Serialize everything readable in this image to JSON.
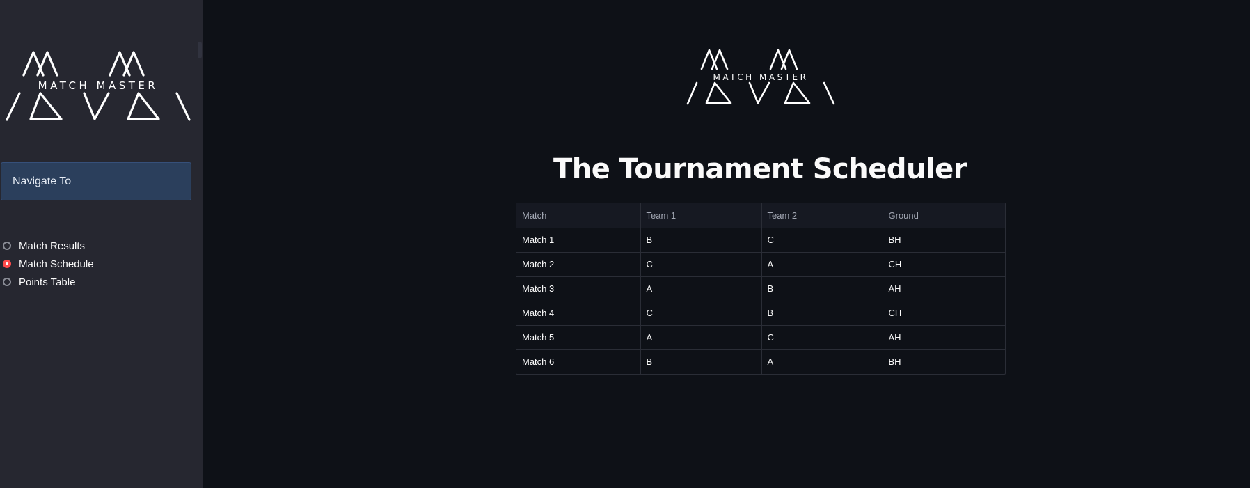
{
  "app": {
    "logo_text": "MATCH MASTER"
  },
  "sidebar": {
    "nav_label": "Navigate To",
    "radio_options": [
      {
        "label": "Match Results",
        "selected": false
      },
      {
        "label": "Match Schedule",
        "selected": true
      },
      {
        "label": "Points Table",
        "selected": false
      }
    ]
  },
  "main": {
    "title": "The Tournament Scheduler",
    "table": {
      "headers": [
        "Match",
        "Team 1",
        "Team 2",
        "Ground"
      ],
      "rows": [
        [
          "Match 1",
          "B",
          "C",
          "BH"
        ],
        [
          "Match 2",
          "C",
          "A",
          "CH"
        ],
        [
          "Match 3",
          "A",
          "B",
          "AH"
        ],
        [
          "Match 4",
          "C",
          "B",
          "CH"
        ],
        [
          "Match 5",
          "A",
          "C",
          "AH"
        ],
        [
          "Match 6",
          "B",
          "A",
          "BH"
        ]
      ]
    }
  },
  "colors": {
    "background": "#0e1117",
    "sidebar": "#262730",
    "nav_box": "#2b3f5c",
    "accent": "#ff4b4b"
  },
  "icons": {
    "logo": "match-master-logo-icon",
    "radio_selected": "radio-selected-icon",
    "radio_unselected": "radio-unselected-icon"
  }
}
